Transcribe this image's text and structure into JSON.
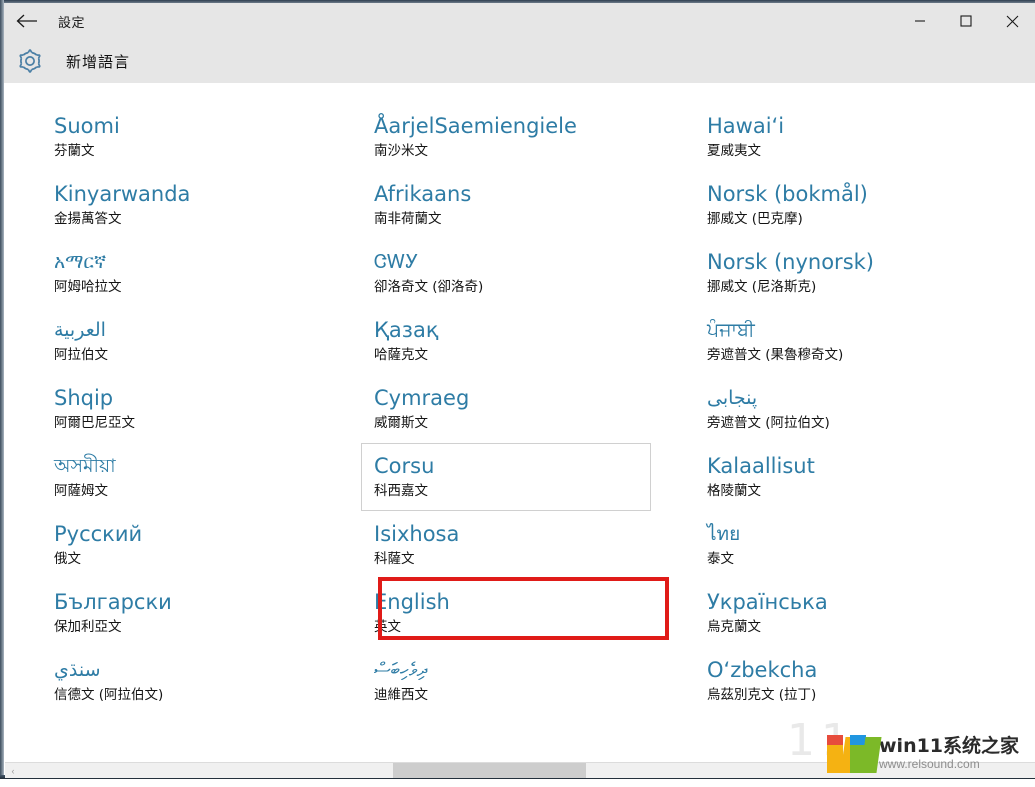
{
  "window": {
    "back_label": "back-arrow",
    "title": "設定",
    "minimize": "–",
    "maximize": "□",
    "close": "✕"
  },
  "header": {
    "icon": "gear-icon",
    "title": "新增語言"
  },
  "columns": [
    {
      "items": [
        {
          "native": "Suomi",
          "local": "芬蘭文",
          "script": "latin"
        },
        {
          "native": "Kinyarwanda",
          "local": "金揚萬答文",
          "script": "latin"
        },
        {
          "native": "አማርኛ",
          "local": "阿姆哈拉文",
          "script": "ethiopic"
        },
        {
          "native": "العربية",
          "local": "阿拉伯文",
          "script": "arabic"
        },
        {
          "native": "Shqip",
          "local": "阿爾巴尼亞文",
          "script": "latin"
        },
        {
          "native": "অসমীয়া",
          "local": "阿薩姆文",
          "script": "bengali"
        },
        {
          "native": "Русский",
          "local": "俄文",
          "script": "cyrillic"
        },
        {
          "native": "Български",
          "local": "保加利亞文",
          "script": "cyrillic"
        },
        {
          "native": "سنڌي",
          "local": "信德文 (阿拉伯文)",
          "script": "arabic"
        }
      ]
    },
    {
      "items": [
        {
          "native": "ÅarjelSaemiengiele",
          "local": "南沙米文",
          "script": "latin"
        },
        {
          "native": "Afrikaans",
          "local": "南非荷蘭文",
          "script": "latin"
        },
        {
          "native": "ᏣᎳᎩ",
          "local": "卻洛奇文 (卻洛奇)",
          "script": "cherokee"
        },
        {
          "native": "Қазақ",
          "local": "哈薩克文",
          "script": "cyrillic"
        },
        {
          "native": "Cymraeg",
          "local": "威爾斯文",
          "script": "latin"
        },
        {
          "native": "Corsu",
          "local": "科西嘉文",
          "script": "latin",
          "state": "focused"
        },
        {
          "native": "Isixhosa",
          "local": "科薩文",
          "script": "latin"
        },
        {
          "native": "English",
          "local": "英文",
          "script": "latin",
          "state": "highlighted"
        },
        {
          "native": "ދިވެހިބަސް",
          "local": "迪維西文",
          "script": "thaana"
        }
      ]
    },
    {
      "items": [
        {
          "native": "Hawai‘i",
          "local": "夏威夷文",
          "script": "latin"
        },
        {
          "native": "Norsk (bokmål)",
          "local": "挪威文 (巴克摩)",
          "script": "latin"
        },
        {
          "native": "Norsk (nynorsk)",
          "local": "挪威文 (尼洛斯克)",
          "script": "latin"
        },
        {
          "native": "ਪੰਜਾਬੀ",
          "local": "旁遮普文 (果魯穆奇文)",
          "script": "gurmukhi"
        },
        {
          "native": "پنجابی",
          "local": "旁遮普文 (阿拉伯文)",
          "script": "arabic"
        },
        {
          "native": "Kalaallisut",
          "local": "格陵蘭文",
          "script": "latin"
        },
        {
          "native": "ไทย",
          "local": "泰文",
          "script": "thai"
        },
        {
          "native": "Українська",
          "local": "烏克蘭文",
          "script": "cyrillic"
        },
        {
          "native": "O‘zbekcha",
          "local": "烏茲別克文 (拉丁)",
          "script": "latin"
        }
      ]
    }
  ],
  "annotation": {
    "name": "english-highlight-rectangle",
    "color": "#e01b18",
    "target": "English"
  },
  "scrollbar": {
    "left_arrow": "‹",
    "orientation": "horizontal"
  },
  "watermark": {
    "title": "win11系统之家",
    "url": "www.relsound.com",
    "ghost": "11"
  },
  "colors": {
    "accent_blue": "#2e7ca5",
    "header_gray": "#e6e6e6",
    "text_black": "#141414",
    "focus_border": "#d0d0d0",
    "annotation_red": "#e01b18",
    "scroll_thumb": "#cdcdcd"
  }
}
